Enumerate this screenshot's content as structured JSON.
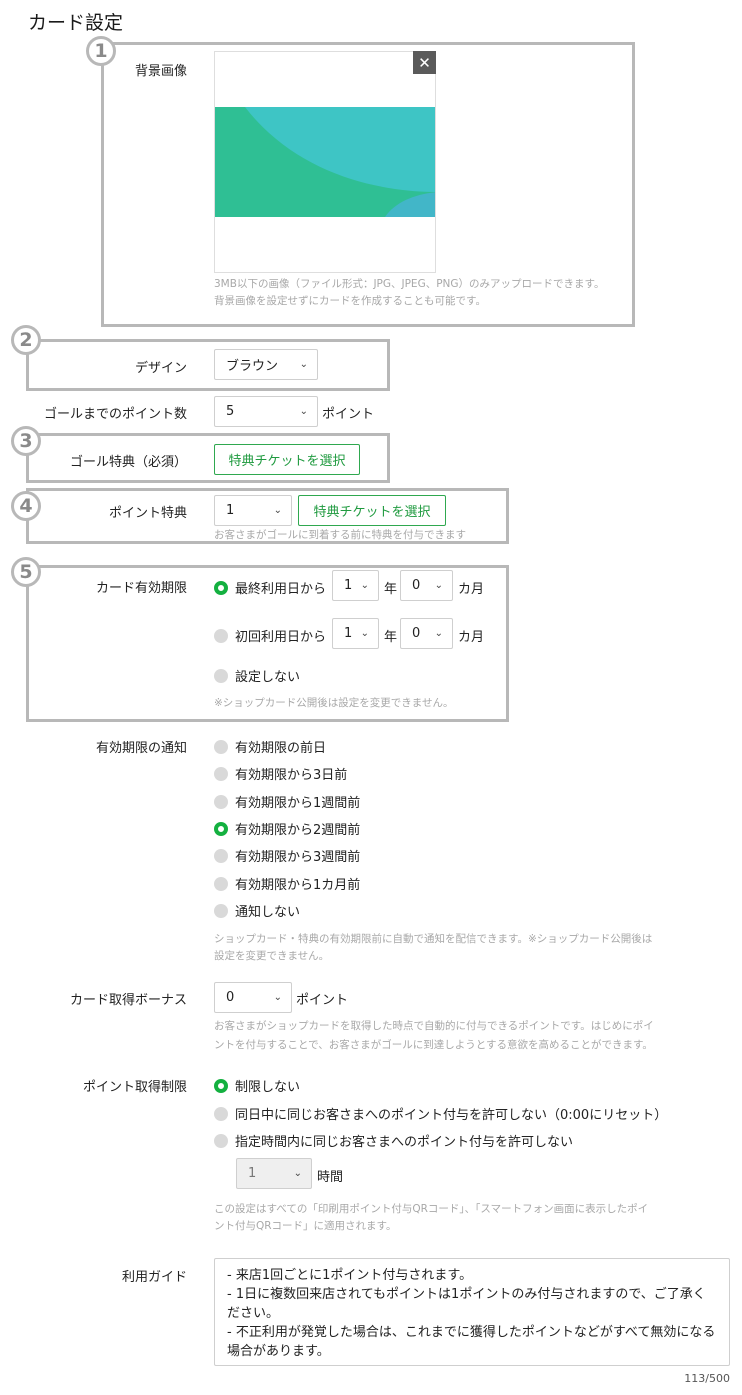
{
  "page_title": "カード設定",
  "callouts": [
    "1",
    "2",
    "3",
    "4",
    "5"
  ],
  "background_image": {
    "label": "背景画像",
    "close_symbol": "✕",
    "hint_line1": "3MB以下の画像（ファイル形式：JPG、JPEG、PNG）のみアップロードできます。",
    "hint_line2": "背景画像を設定せずにカードを作成することも可能です。",
    "colors": {
      "teal": "#3ec5c5",
      "green": "#2fbf94",
      "blue": "#42b6c8"
    }
  },
  "design": {
    "label": "デザイン",
    "value": "ブラウン"
  },
  "goal_points": {
    "label": "ゴールまでのポイント数",
    "value": "5",
    "unit": "ポイント"
  },
  "goal_reward": {
    "label": "ゴール特典（必須）",
    "button": "特典チケットを選択"
  },
  "point_reward": {
    "label": "ポイント特典",
    "value": "1",
    "button": "特典チケットを選択",
    "hint": "お客さまがゴールに到着する前に特典を付与できます"
  },
  "card_expiry": {
    "label": "カード有効期限",
    "options": [
      {
        "label": "最終利用日から",
        "selected": true,
        "year_value": "1",
        "year_unit": "年",
        "month_value": "0",
        "month_unit": "カ月"
      },
      {
        "label": "初回利用日から",
        "selected": false,
        "year_value": "1",
        "year_unit": "年",
        "month_value": "0",
        "month_unit": "カ月"
      },
      {
        "label": "設定しない",
        "selected": false
      }
    ],
    "hint": "※ショップカード公開後は設定を変更できません。"
  },
  "expiry_notice": {
    "label": "有効期限の通知",
    "options": [
      {
        "label": "有効期限の前日",
        "selected": false
      },
      {
        "label": "有効期限から3日前",
        "selected": false
      },
      {
        "label": "有効期限から1週間前",
        "selected": false
      },
      {
        "label": "有効期限から2週間前",
        "selected": true
      },
      {
        "label": "有効期限から3週間前",
        "selected": false
      },
      {
        "label": "有効期限から1カ月前",
        "selected": false
      },
      {
        "label": "通知しない",
        "selected": false
      }
    ],
    "hint_line1": "ショップカード・特典の有効期限前に自動で通知を配信できます。※ショップカード公開後は",
    "hint_line2": "設定を変更できません。"
  },
  "card_bonus": {
    "label": "カード取得ボーナス",
    "value": "0",
    "unit": "ポイント",
    "hint_line1": "お客さまがショップカードを取得した時点で自動的に付与できるポイントです。はじめにポイ",
    "hint_line2": "ントを付与することで、お客さまがゴールに到達しようとする意欲を高めることができます。"
  },
  "point_limit": {
    "label": "ポイント取得制限",
    "options": [
      {
        "label": "制限しない",
        "selected": true
      },
      {
        "label": "同日中に同じお客さまへのポイント付与を許可しない（0:00にリセット）",
        "selected": false
      },
      {
        "label": "指定時間内に同じお客さまへのポイント付与を許可しない",
        "selected": false
      }
    ],
    "hours_value": "1",
    "hours_unit": "時間",
    "hint_line1": "この設定はすべての「印刷用ポイント付与QRコード」、「スマートフォン画面に表示したポイ",
    "hint_line2": "ント付与QRコード」に適用されます。"
  },
  "usage_guide": {
    "label": "利用ガイド",
    "text": "- 来店1回ごとに1ポイント付与されます。\n- 1日に複数回来店されてもポイントは1ポイントのみ付与されますので、ご了承ください。\n- 不正利用が発覚した場合は、これまでに獲得したポイントなどがすべて無効になる場合があります。",
    "counter": "113/500"
  }
}
